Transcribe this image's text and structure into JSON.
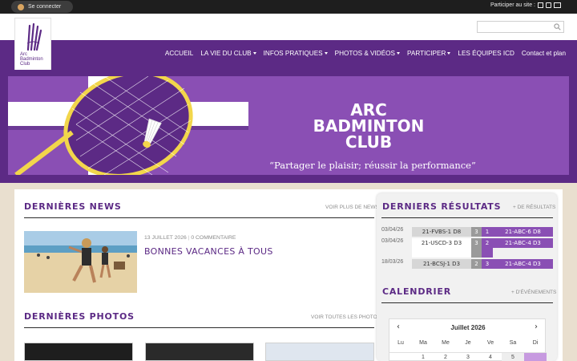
{
  "topbar": {
    "login_label": "Se connecter",
    "participate_label": "Participer au site :"
  },
  "logo": {
    "line1": "Arc",
    "line2": "Badminton",
    "line3": "Club"
  },
  "nav": {
    "items": [
      {
        "label": "ACCUEIL",
        "dropdown": false
      },
      {
        "label": "LA VIE DU CLUB",
        "dropdown": true
      },
      {
        "label": "INFOS PRATIQUES",
        "dropdown": true
      },
      {
        "label": "PHOTOS & VIDÉOS",
        "dropdown": true
      },
      {
        "label": "PARTICIPER",
        "dropdown": true
      },
      {
        "label": "LES ÉQUIPES ICD",
        "dropdown": false
      },
      {
        "label": "Contact et plan",
        "dropdown": false
      }
    ]
  },
  "banner": {
    "title_line1": "ARC",
    "title_line2": "BADMINTON",
    "title_line3": "CLUB",
    "slogan": "“Partager le plaisir; réussir la performance”"
  },
  "news": {
    "title": "DERNIÈRES NEWS",
    "more_link": "VOIR PLUS DE NEWS",
    "item": {
      "date": "13 JUILLET 2026",
      "comments": "0 COMMENTAIRE",
      "headline": "BONNES VACANCES À TOUS"
    }
  },
  "photos": {
    "title": "DERNIÈRES PHOTOS",
    "more_link": "VOIR TOUTES LES PHOTOS"
  },
  "results": {
    "title": "DERNIERS RÉSULTATS",
    "more_link": "+ DE RÉSULTATS",
    "rows": [
      {
        "date": "03/04/26",
        "home": "21-FVBS-1 D8",
        "score_home": "3",
        "score_away": "1",
        "away": "21-ABC-6 D8"
      },
      {
        "date": "03/04/26",
        "home": "21-USCD-3 D3",
        "score_home": "3",
        "score_away": "2",
        "away": "21-ABC-4 D3"
      },
      {
        "date": "18/03/26",
        "home": "21-BCSJ-1 D3",
        "score_home": "2",
        "score_away": "3",
        "away": "21-ABC-4 D3"
      }
    ]
  },
  "calendar": {
    "title": "CALENDRIER",
    "more_link": "+ D'ÉVÉNEMENTS",
    "month": "Juillet 2026",
    "weekdays": [
      "Lu",
      "Ma",
      "Me",
      "Je",
      "Ve",
      "Sa",
      "Di"
    ],
    "first_row": [
      "",
      "1",
      "2",
      "3",
      "4",
      "5",
      ""
    ]
  },
  "colors": {
    "brand_purple": "#5c2a85",
    "banner_purple": "#8a4fb4",
    "accent_yellow": "#f2d64b"
  }
}
